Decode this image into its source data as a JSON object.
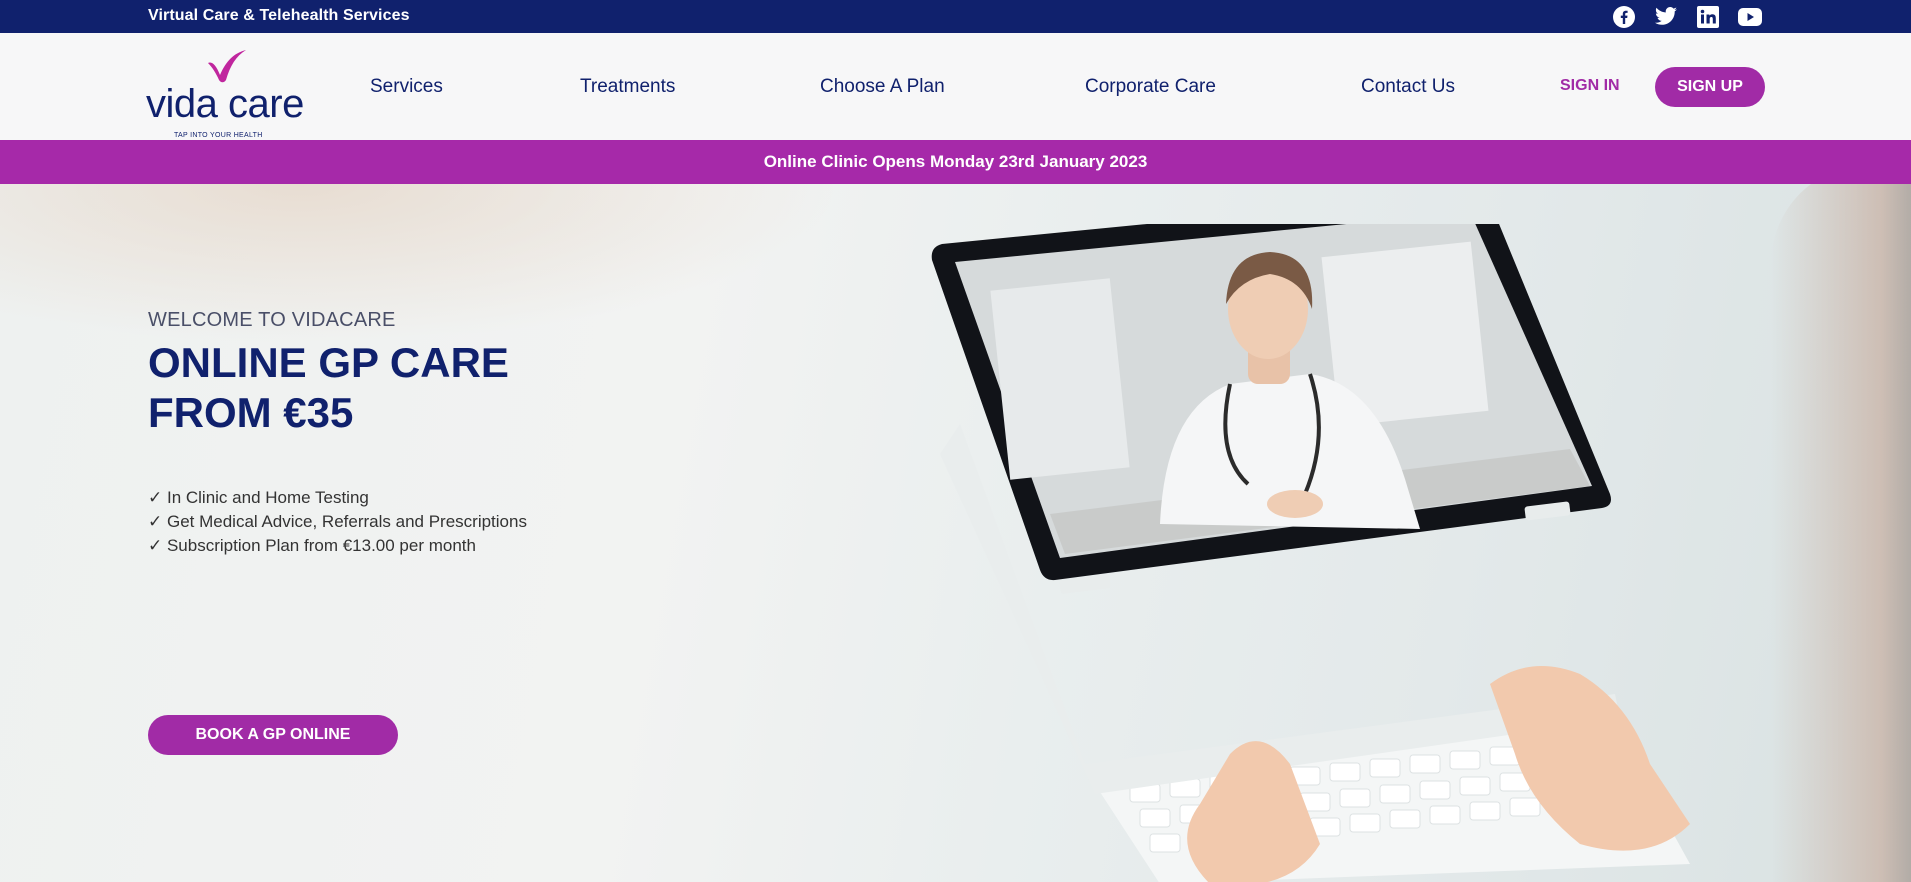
{
  "topbar": {
    "tagline": "Virtual Care & Telehealth Services",
    "social_icons": [
      "facebook-icon",
      "twitter-icon",
      "linkedin-icon",
      "youtube-icon"
    ]
  },
  "header": {
    "logo": {
      "word1": "vida",
      "word2": "care",
      "slogan": "TAP INTO YOUR HEALTH"
    },
    "nav": [
      {
        "label": "Services"
      },
      {
        "label": "Treatments"
      },
      {
        "label": "Choose A Plan"
      },
      {
        "label": "Corporate Care"
      },
      {
        "label": "Contact Us"
      }
    ],
    "signin_label": "SIGN IN",
    "signup_label": "SIGN UP"
  },
  "announcement": {
    "text": "Online Clinic Opens Monday 23rd January 2023"
  },
  "hero": {
    "welcome": "WELCOME TO VIDACARE",
    "headline_line1": "ONLINE GP CARE",
    "headline_line2": "FROM €35",
    "benefits": [
      "✓ In Clinic and Home Testing",
      "✓ Get Medical Advice, Referrals and Prescriptions",
      "✓ Subscription Plan from €13.00 per month"
    ],
    "cta_label": "BOOK A GP ONLINE"
  },
  "colors": {
    "navy": "#10216d",
    "purple": "#a12ba6",
    "announcement_bg": "#a629a9"
  }
}
